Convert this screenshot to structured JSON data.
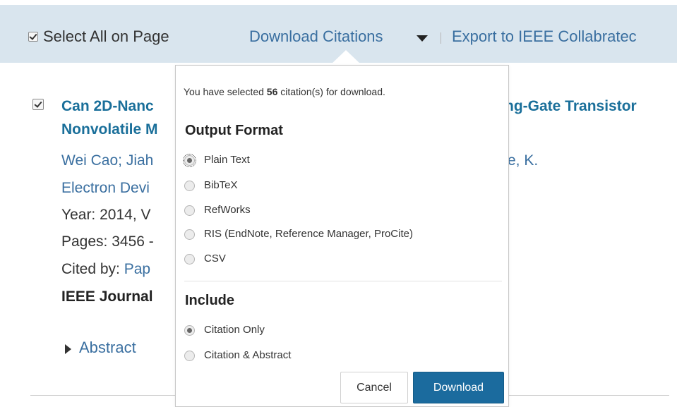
{
  "toolbar": {
    "select_all_label": "Select All on Page",
    "download_citations_label": "Download Citations",
    "export_label": "Export to IEEE Collabratec"
  },
  "result": {
    "title_left_1": "Can 2D-Nanc",
    "title_left_2": "Nonvolatile M",
    "title_right_1": "ng-Gate Transistor",
    "authors_left": "Wei Cao; Jiah",
    "authors_right": "e, K.",
    "journal_left": "Electron Devi",
    "year_left": "Year: 2014, V",
    "pages_left": "Pages: 3456 -",
    "cited_prefix": "Cited by: ",
    "cited_link": "Pap",
    "venue_left": "IEEE Journal",
    "abstract_label": "Abstract"
  },
  "popup": {
    "info_prefix": "You have selected ",
    "info_count": "56",
    "info_suffix": " citation(s) for download.",
    "output_format_heading": "Output Format",
    "formats": [
      {
        "label": "Plain Text",
        "selected": true
      },
      {
        "label": "BibTeX",
        "selected": false
      },
      {
        "label": "RefWorks",
        "selected": false
      },
      {
        "label": "RIS (EndNote, Reference Manager, ProCite)",
        "selected": false
      },
      {
        "label": "CSV",
        "selected": false
      }
    ],
    "include_heading": "Include",
    "include_options": [
      {
        "label": "Citation Only",
        "selected": true
      },
      {
        "label": "Citation & Abstract",
        "selected": false
      }
    ],
    "cancel_label": "Cancel",
    "download_label": "Download"
  },
  "colors": {
    "toolbar_bg": "#d9e5ee",
    "link": "#3a6fa0",
    "title": "#1a6f9a",
    "primary_button": "#1b6b9e"
  },
  "icons": {
    "dropdown": "caret-down-icon",
    "abstract_toggle": "caret-right-icon"
  }
}
